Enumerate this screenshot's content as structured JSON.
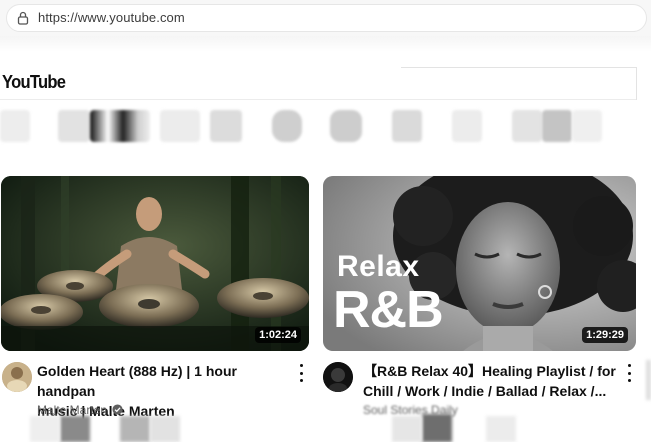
{
  "browser": {
    "url": "https://www.youtube.com"
  },
  "youtube": {
    "logo_text": "YouTube"
  },
  "videos": [
    {
      "title_line1": "Golden Heart (888 Hz) | 1 hour handpan",
      "title_line2": "music | Malte Marten",
      "channel": "Malte Marten",
      "duration": "1:02:24"
    },
    {
      "title_line1": "【R&B Relax 40】Healing Playlist / for",
      "title_line2": "Chill / Work / Indie / Ballad / Relax /...",
      "channel": "Soul Stories Daily",
      "duration": "1:29:29",
      "thumb_text_1": "Relax",
      "thumb_text_2": "R&B"
    }
  ],
  "colors": {
    "accent_text": "#0f0f0f",
    "secondary_text": "#606060",
    "duration_bg": "#000000"
  },
  "icons": [
    "lock-icon",
    "verified-icon",
    "more-vert-icon"
  ]
}
